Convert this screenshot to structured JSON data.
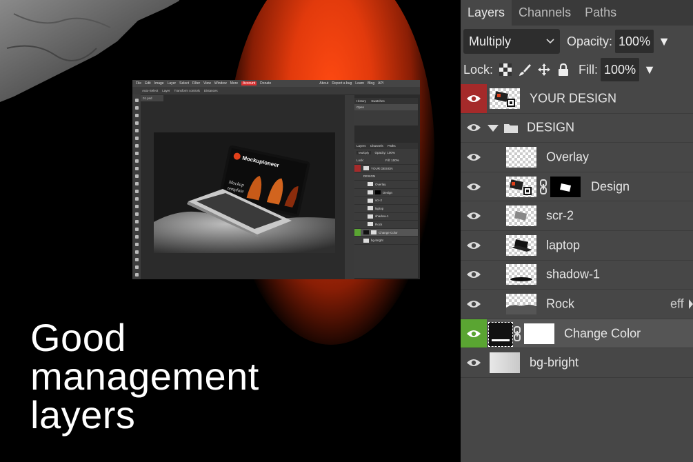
{
  "headline": {
    "line1": "Good",
    "line2": "management",
    "line3": "layers"
  },
  "colors": {
    "accent_orange": "#ff4a12",
    "eye_red": "#a52a2a",
    "eye_green": "#5aa532",
    "panel_bg": "#474747"
  },
  "mini_screenshot": {
    "menu": [
      "File",
      "Edit",
      "Image",
      "Layer",
      "Select",
      "Filter",
      "View",
      "Window",
      "More",
      "Account",
      "Donate"
    ],
    "menu_right": [
      "About",
      "Report a bug",
      "Learn",
      "Blog",
      "API"
    ],
    "options": [
      "Auto-Select",
      "Layer",
      "Transform controls",
      "Distances"
    ],
    "doc_tab": "01.psd",
    "history_tabs": [
      "History",
      "Swatches"
    ],
    "history_items": [
      "Open"
    ],
    "layer_tabs": [
      "Layers",
      "Channels",
      "Paths"
    ],
    "blend": "Multiply",
    "opacity_label": "Opacity:",
    "opacity": "100%",
    "lock_label": "Lock:",
    "fill_label": "Fill:",
    "fill": "100%",
    "brand": "Mockupioneer",
    "mockup_text_1": "Mockup",
    "mockup_text_2": "template",
    "layers": [
      "YOUR DESIGN",
      "DESIGN",
      "Overlay",
      "Design",
      "scr-2",
      "laptop",
      "shadow-1",
      "Rock",
      "Change Color",
      "bg-bright"
    ]
  },
  "panel": {
    "tabs": [
      "Layers",
      "Channels",
      "Paths"
    ],
    "blend_mode": "Multiply",
    "opacity_label": "Opacity:",
    "opacity_value": "100%",
    "lock_label": "Lock:",
    "fill_label": "Fill:",
    "fill_value": "100%",
    "layers": [
      {
        "name": "YOUR DESIGN"
      },
      {
        "name": "DESIGN"
      },
      {
        "name": "Overlay"
      },
      {
        "name": "Design"
      },
      {
        "name": "scr-2"
      },
      {
        "name": "laptop"
      },
      {
        "name": "shadow-1"
      },
      {
        "name": "Rock",
        "fx": "eff"
      },
      {
        "name": "Change Color"
      },
      {
        "name": "bg-bright"
      }
    ]
  }
}
